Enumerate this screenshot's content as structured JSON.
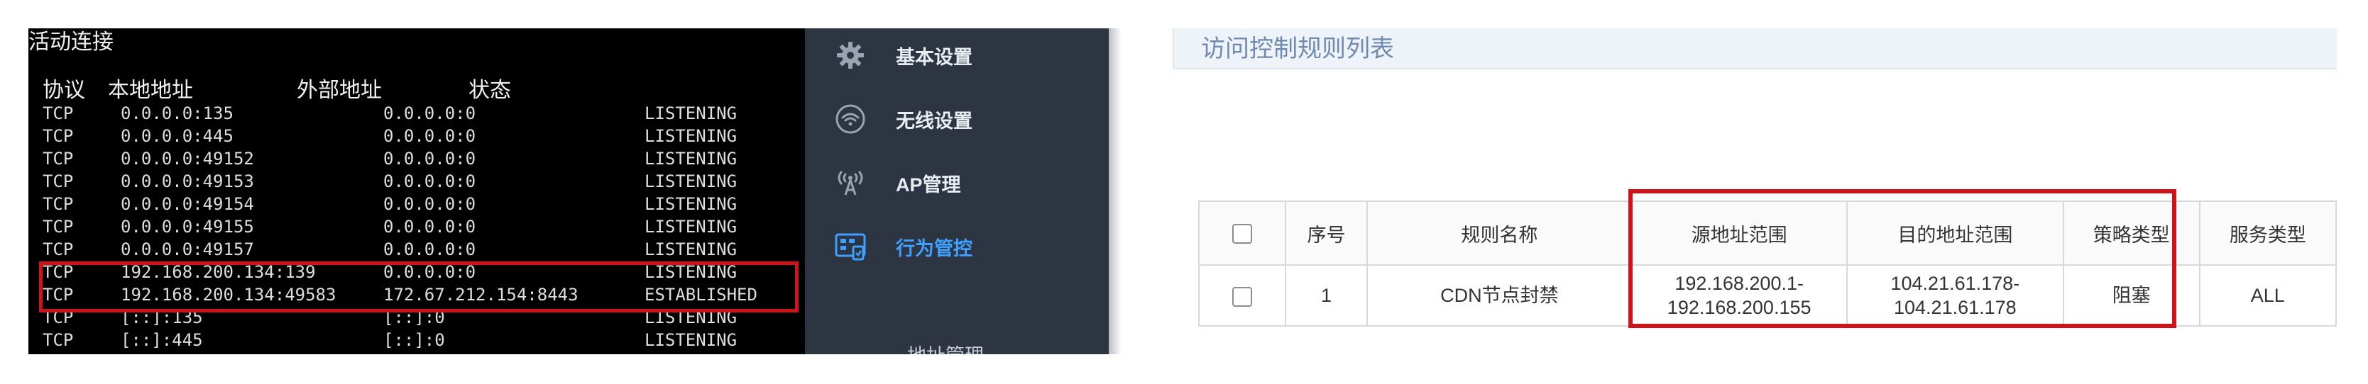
{
  "terminal": {
    "title": "活动连接",
    "headers": {
      "protocol": "协议",
      "local": "本地地址",
      "foreign": "外部地址",
      "state": "状态"
    },
    "rows": [
      {
        "proto": "TCP",
        "local": "0.0.0.0:135",
        "foreign": "0.0.0.0:0",
        "state": "LISTENING"
      },
      {
        "proto": "TCP",
        "local": "0.0.0.0:445",
        "foreign": "0.0.0.0:0",
        "state": "LISTENING"
      },
      {
        "proto": "TCP",
        "local": "0.0.0.0:49152",
        "foreign": "0.0.0.0:0",
        "state": "LISTENING"
      },
      {
        "proto": "TCP",
        "local": "0.0.0.0:49153",
        "foreign": "0.0.0.0:0",
        "state": "LISTENING"
      },
      {
        "proto": "TCP",
        "local": "0.0.0.0:49154",
        "foreign": "0.0.0.0:0",
        "state": "LISTENING"
      },
      {
        "proto": "TCP",
        "local": "0.0.0.0:49155",
        "foreign": "0.0.0.0:0",
        "state": "LISTENING"
      },
      {
        "proto": "TCP",
        "local": "0.0.0.0:49157",
        "foreign": "0.0.0.0:0",
        "state": "LISTENING"
      },
      {
        "proto": "TCP",
        "local": "192.168.200.134:139",
        "foreign": "0.0.0.0:0",
        "state": "LISTENING"
      },
      {
        "proto": "TCP",
        "local": "192.168.200.134:49583",
        "foreign": "172.67.212.154:8443",
        "state": "ESTABLISHED"
      },
      {
        "proto": "TCP",
        "local": "[::]:135",
        "foreign": "[::]:0",
        "state": "LISTENING"
      },
      {
        "proto": "TCP",
        "local": "[::]:445",
        "foreign": "[::]:0",
        "state": "LISTENING"
      }
    ]
  },
  "nav": {
    "items": [
      {
        "label": "基本设置",
        "icon": "gear-icon"
      },
      {
        "label": "无线设置",
        "icon": "wifi-icon"
      },
      {
        "label": "AP管理",
        "icon": "access-point-icon"
      },
      {
        "label": "行为管控",
        "icon": "behavior-control-icon",
        "active": true
      }
    ],
    "sub_item": "地址管理",
    "active_color": "#3ea1ff"
  },
  "content": {
    "list_title": "访问控制规则列表",
    "table": {
      "headers": [
        "序号",
        "规则名称",
        "源地址范围",
        "目的地址范围",
        "策略类型",
        "服务类型"
      ],
      "rows": [
        {
          "index": "1",
          "name": "CDN节点封禁",
          "src_start": "192.168.200.1-",
          "src_end": "192.168.200.155",
          "dst_start": "104.21.61.178-",
          "dst_end": "104.21.61.178",
          "policy": "阻塞",
          "service": "ALL"
        }
      ]
    }
  },
  "colors": {
    "highlight": "#d0121b",
    "nav_bg": "#2d3442",
    "terminal_bg": "#000000"
  }
}
